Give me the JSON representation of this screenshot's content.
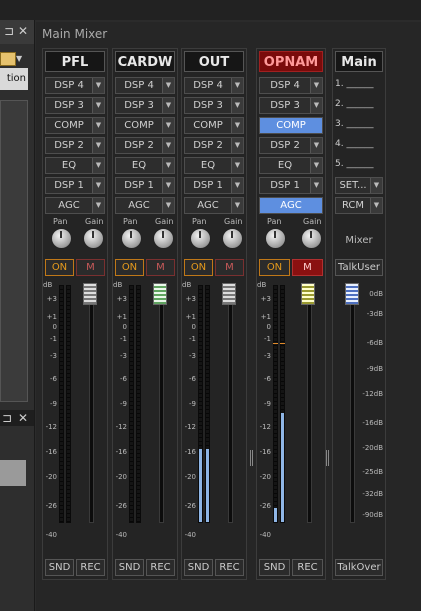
{
  "left_panel": {
    "tab_text": "tion",
    "close_glyph": "✕",
    "pin_glyph": "⊐",
    "dropdown_glyph": "▼"
  },
  "panel": {
    "title": "Main Mixer",
    "close_glyph": "✕"
  },
  "dropdown_glyph": "▼",
  "knob_labels": {
    "pan": "Pan",
    "gain": "Gain"
  },
  "channel_scale": [
    "+3",
    "+1",
    "0",
    "-1",
    "-3",
    "-6",
    "-9",
    "-12",
    "-16",
    "-20",
    "-26",
    "-40"
  ],
  "channels": [
    {
      "name": "PFL",
      "slots": [
        "DSP 4",
        "DSP 3",
        "COMP",
        "DSP 2",
        "EQ",
        "DSP 1",
        "AGC"
      ],
      "on": "ON",
      "mute": "M",
      "db": "dB",
      "snd": "SND",
      "rec": "REC",
      "level_l": 0,
      "level_r": 0,
      "fader_color": "white"
    },
    {
      "name": "CARDW",
      "slots": [
        "DSP 4",
        "DSP 3",
        "COMP",
        "DSP 2",
        "EQ",
        "DSP 1",
        "AGC"
      ],
      "on": "ON",
      "mute": "M",
      "db": "dB",
      "snd": "SND",
      "rec": "REC",
      "level_l": 0,
      "level_r": 0,
      "fader_color": "green"
    },
    {
      "name": "OUT",
      "slots": [
        "DSP 4",
        "DSP 3",
        "COMP",
        "DSP 2",
        "EQ",
        "DSP 1",
        "AGC"
      ],
      "on": "ON",
      "mute": "M",
      "db": "dB",
      "snd": "SND",
      "rec": "REC",
      "level_l": 0.31,
      "level_r": 0.31,
      "fader_color": "white"
    },
    {
      "name": "OPNAM",
      "slots": [
        "DSP 4",
        "DSP 3",
        "COMP",
        "DSP 2",
        "EQ",
        "DSP 1",
        "AGC"
      ],
      "on": "ON",
      "mute": "M",
      "db": "dB",
      "snd": "SND",
      "rec": "REC",
      "level_l": 0.06,
      "level_r": 0.46,
      "fader_color": "yellow",
      "highlighted_slots": [
        "COMP",
        "AGC"
      ],
      "name_red": true,
      "mute_active": true
    }
  ],
  "main": {
    "name": "Main",
    "lines": [
      "1. ______",
      "2. ______",
      "3. ______",
      "4. ______",
      "5. ______"
    ],
    "set_label": "SET...",
    "rcm_label": "RCM",
    "mixer_label": "Mixer",
    "talkuser": "TalkUser",
    "talkover": "TalkOver",
    "scale": [
      "0dB",
      "-3dB",
      "-6dB",
      "-9dB",
      "-12dB",
      "-16dB",
      "-20dB",
      "-25dB",
      "-32dB",
      "-90dB"
    ]
  }
}
